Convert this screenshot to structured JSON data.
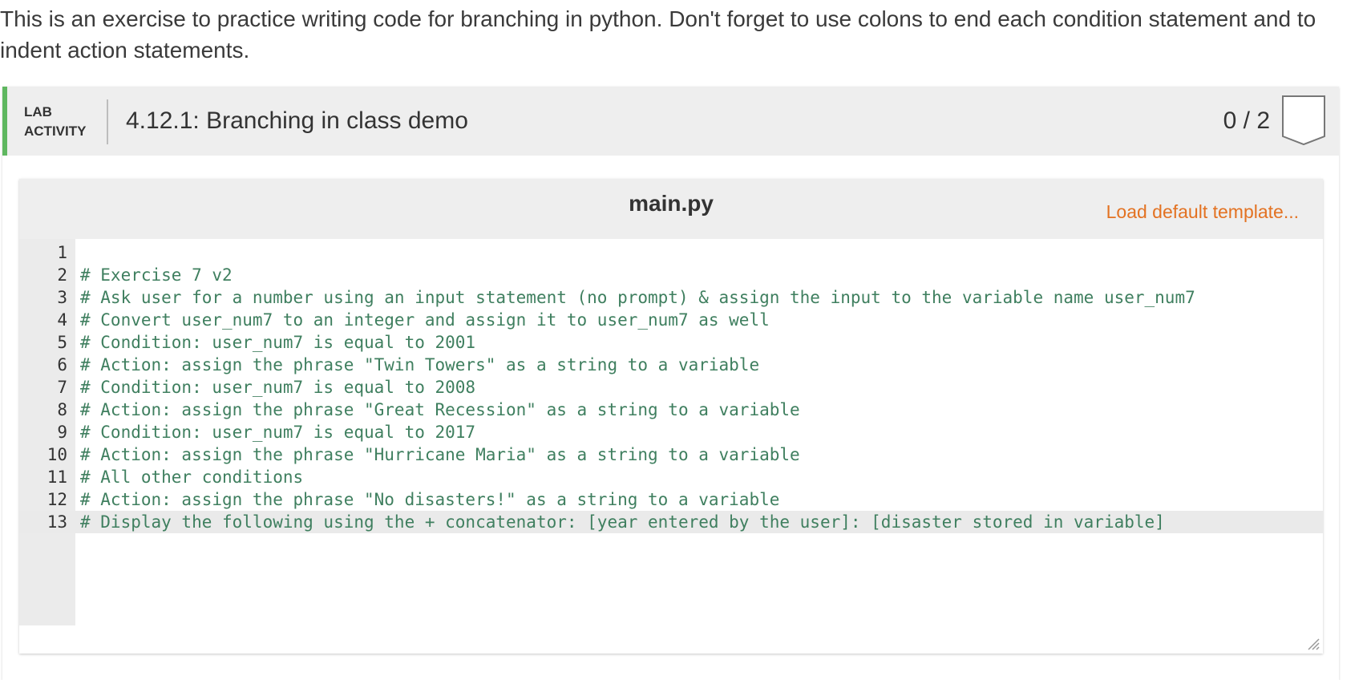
{
  "intro": {
    "text": "This is an exercise to practice writing code for branching in python. Don't forget to use colons to end each condition statement and to indent action statements."
  },
  "lab": {
    "type_line1": "LAB",
    "type_line2": "ACTIVITY",
    "title": "4.12.1: Branching in class demo",
    "score": "0 / 2",
    "accent_color": "#5fb760"
  },
  "editor": {
    "file_name": "main.py",
    "load_template_label": "Load default template...",
    "link_color": "#e37222",
    "comment_color": "#3f7f5f",
    "active_line": 13,
    "lines": [
      {
        "num": "1",
        "text": ""
      },
      {
        "num": "2",
        "text": "# Exercise 7 v2"
      },
      {
        "num": "3",
        "text": "# Ask user for a number using an input statement (no prompt) & assign the input to the variable name user_num7"
      },
      {
        "num": "4",
        "text": "# Convert user_num7 to an integer and assign it to user_num7 as well"
      },
      {
        "num": "5",
        "text": "# Condition: user_num7 is equal to 2001"
      },
      {
        "num": "6",
        "text": "# Action: assign the phrase \"Twin Towers\" as a string to a variable"
      },
      {
        "num": "7",
        "text": "# Condition: user_num7 is equal to 2008"
      },
      {
        "num": "8",
        "text": "# Action: assign the phrase \"Great Recession\" as a string to a variable"
      },
      {
        "num": "9",
        "text": "# Condition: user_num7 is equal to 2017"
      },
      {
        "num": "10",
        "text": "# Action: assign the phrase \"Hurricane Maria\" as a string to a variable"
      },
      {
        "num": "11",
        "text": "# All other conditions"
      },
      {
        "num": "12",
        "text": "# Action: assign the phrase \"No disasters!\" as a string to a variable"
      },
      {
        "num": "13",
        "text": "# Display the following using the + concatenator: [year entered by the user]: [disaster stored in variable]"
      }
    ]
  }
}
